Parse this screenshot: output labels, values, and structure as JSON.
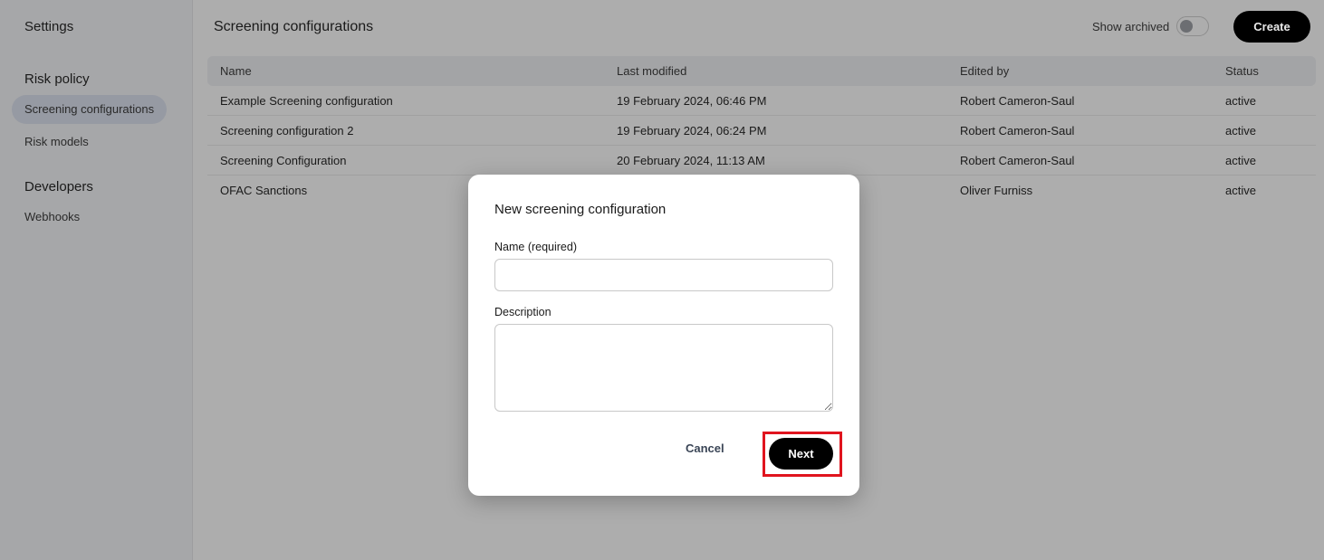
{
  "sidebar": {
    "title": "Settings",
    "sections": [
      {
        "heading": "Risk policy",
        "items": [
          "Screening configurations",
          "Risk models"
        ]
      },
      {
        "heading": "Developers",
        "items": [
          "Webhooks"
        ]
      }
    ]
  },
  "header": {
    "title": "Screening configurations",
    "show_archived_label": "Show archived",
    "show_archived": false,
    "create_label": "Create"
  },
  "table": {
    "columns": [
      "Name",
      "Last modified",
      "Edited by",
      "Status"
    ],
    "rows": [
      [
        "Example Screening configuration",
        "19 February 2024, 06:46 PM",
        "Robert Cameron-Saul",
        "active"
      ],
      [
        "Screening configuration 2",
        "19 February 2024, 06:24 PM",
        "Robert Cameron-Saul",
        "active"
      ],
      [
        "Screening Configuration",
        "20 February 2024, 11:13 AM",
        "Robert Cameron-Saul",
        "active"
      ],
      [
        "OFAC Sanctions",
        "",
        "Oliver Furniss",
        "active"
      ]
    ]
  },
  "modal": {
    "title": "New screening configuration",
    "name_label": "Name (required)",
    "name_value": "",
    "description_label": "Description",
    "description_value": "",
    "cancel_label": "Cancel",
    "next_label": "Next"
  }
}
